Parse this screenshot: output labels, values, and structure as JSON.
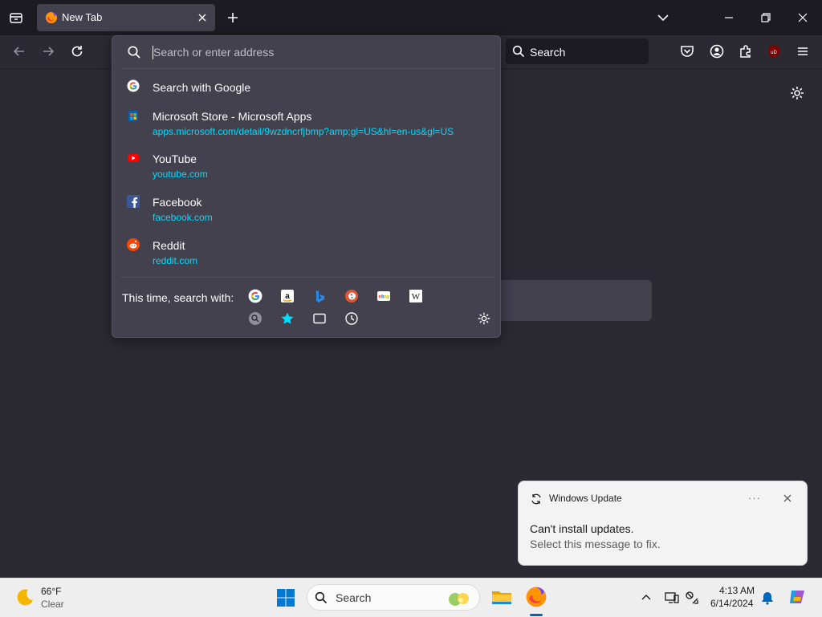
{
  "browser": {
    "tab_title": "New Tab",
    "colors": {
      "accent": "#00ddff",
      "tab_active": "#42414d",
      "chrome": "#1c1b22",
      "panel": "#42414d"
    },
    "toolbar_search_placeholder": "Search",
    "icons": [
      "tab-list-icon",
      "close-icon",
      "plus-icon",
      "chevron-down-icon",
      "minimize-icon",
      "restore-icon",
      "window-close-icon",
      "back-icon",
      "forward-icon",
      "reload-icon",
      "search-icon",
      "pocket-icon",
      "account-icon",
      "extensions-icon",
      "ublock-icon",
      "menu-icon",
      "gear-icon"
    ]
  },
  "urlbar": {
    "placeholder": "Search or enter address",
    "results": [
      {
        "title": "Search with Google",
        "url": "",
        "icon": "google-icon"
      },
      {
        "title": "Microsoft Store - Microsoft Apps",
        "url": "apps.microsoft.com/detail/9wzdncrfjbmp?amp;gl=US&hl=en-us&gl=US",
        "icon": "microsoft-store-icon"
      },
      {
        "title": "YouTube",
        "url": "youtube.com",
        "icon": "youtube-icon"
      },
      {
        "title": "Facebook",
        "url": "facebook.com",
        "icon": "facebook-icon"
      },
      {
        "title": "Reddit",
        "url": "reddit.com",
        "icon": "reddit-icon"
      }
    ],
    "oneoff_label": "This time, search with:",
    "oneoff_engines": [
      "google",
      "amazon",
      "bing",
      "duckduckgo",
      "ebay",
      "wikipedia"
    ],
    "oneoff_modes": [
      "tabs",
      "bookmarks",
      "tabs-window",
      "history"
    ],
    "ublock_badge": "uD"
  },
  "notification": {
    "app": "Windows Update",
    "title": "Can't install updates.",
    "message": "Select this message to fix.",
    "more": "···"
  },
  "taskbar": {
    "weather_temp": "66°F",
    "weather_cond": "Clear",
    "search_label": "Search",
    "time": "4:13 AM",
    "date": "6/14/2024"
  }
}
